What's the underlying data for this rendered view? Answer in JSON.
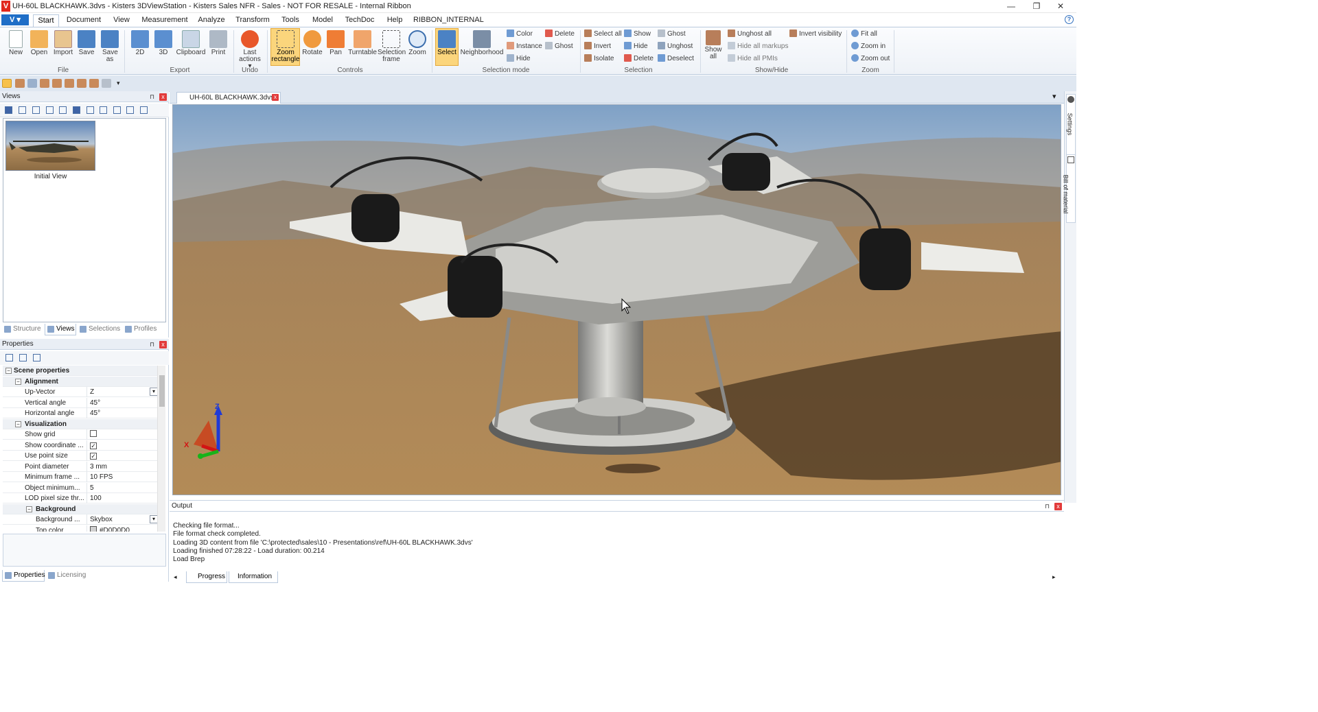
{
  "window": {
    "title": "UH-60L BLACKHAWK.3dvs - Kisters 3DViewStation - Kisters Sales NFR - Sales - NOT FOR RESALE - Internal Ribbon",
    "logo": "V",
    "minimize": "—",
    "restore": "❐",
    "close": "✕"
  },
  "menu": {
    "app_button": "V ▾",
    "help": "?",
    "tabs": [
      "Start",
      "Document",
      "View",
      "Measurement",
      "Analyze",
      "Transform",
      "Tools",
      "Model",
      "TechDoc",
      "Help",
      "RIBBON_INTERNAL"
    ]
  },
  "ribbon": {
    "file": {
      "new": "New",
      "open": "Open",
      "import": "Import",
      "save": "Save",
      "save_as": "Save as",
      "group": "File"
    },
    "export": {
      "2d": "2D",
      "3d": "3D",
      "clipboard": "Clipboard",
      "print": "Print",
      "group": "Export"
    },
    "undo": {
      "last_actions": "Last actions ▾",
      "group": "Undo"
    },
    "controls": {
      "zoom_rectangle": "Zoom rectangle",
      "rotate": "Rotate",
      "pan": "Pan",
      "turntable": "Turntable",
      "selection_frame": "Selection frame",
      "zoom": "Zoom",
      "group": "Controls"
    },
    "selection_mode": {
      "select": "Select",
      "neighborhood": "Neighborhood",
      "color": "Color",
      "instance": "Instance",
      "hide": "Hide",
      "delete": "Delete",
      "ghost": "Ghost",
      "group": "Selection mode"
    },
    "selection": {
      "select_all": "Select all",
      "invert": "Invert",
      "isolate": "Isolate",
      "show": "Show",
      "hide": "Hide",
      "delete": "Delete",
      "ghost": "Ghost",
      "unghost": "Unghost",
      "deselect": "Deselect",
      "group": "Selection"
    },
    "showhide": {
      "show_all": "Show all",
      "unghost_all": "Unghost all",
      "hide_all_markups": "Hide all markups",
      "hide_all_pmis": "Hide all PMIs",
      "invert_visibility": "Invert visibility",
      "group": "Show/Hide"
    },
    "zoom": {
      "fit_all": "Fit all",
      "zoom_in": "Zoom in",
      "zoom_out": "Zoom out",
      "group": "Zoom"
    }
  },
  "views_panel": {
    "title": "Views",
    "pin": "⊓",
    "close": "x",
    "thumbnail_label": "Initial View",
    "tabs": [
      "Structure",
      "Views",
      "Selections",
      "Profiles"
    ]
  },
  "properties_panel": {
    "title": "Properties",
    "close": "x",
    "rows": [
      {
        "key": "Scene properties",
        "value": ""
      },
      {
        "key": "Alignment",
        "value": ""
      },
      {
        "key": "Up-Vector",
        "value": "Z"
      },
      {
        "key": "Vertical angle",
        "value": "45°"
      },
      {
        "key": "Horizontal angle",
        "value": "45°"
      },
      {
        "key": "Visualization",
        "value": ""
      },
      {
        "key": "Show grid",
        "value": ""
      },
      {
        "key": "Show coordinate ...",
        "value": "✓"
      },
      {
        "key": "Use point size",
        "value": "✓"
      },
      {
        "key": "Point diameter",
        "value": "3 mm"
      },
      {
        "key": "Minimum frame ...",
        "value": "10 FPS"
      },
      {
        "key": "Object minimum...",
        "value": "5"
      },
      {
        "key": "LOD pixel size thr...",
        "value": "100"
      },
      {
        "key": "Background",
        "value": ""
      },
      {
        "key": "Background ...",
        "value": "Skybox"
      },
      {
        "key": "Top color",
        "value": "#D0D0D0"
      }
    ],
    "tabs": [
      "Properties",
      "Licensing"
    ]
  },
  "document": {
    "tab": "UH-60L BLACKHAWK.3dvs",
    "tab_close": "x",
    "dropdown": "▾",
    "axis_x": "X",
    "axis_z": "Z"
  },
  "sidebar": {
    "settings": "Settings",
    "bom": "Bill of material"
  },
  "output": {
    "title": "Output",
    "lines": [
      "Checking file format...",
      "File format check completed.",
      "Loading 3D content from file 'C:\\protected\\sales\\10 - Presentations\\ref\\UH-60L BLACKHAWK.3dvs'",
      "Loading finished 07:28:22 - Load duration: 00.214",
      "Load Brep"
    ],
    "tabs": [
      "Progress",
      "Information"
    ]
  },
  "colors": {
    "accent": "#1f6ec7",
    "select_active": "#f7c14a",
    "close": "#e23b3b"
  }
}
